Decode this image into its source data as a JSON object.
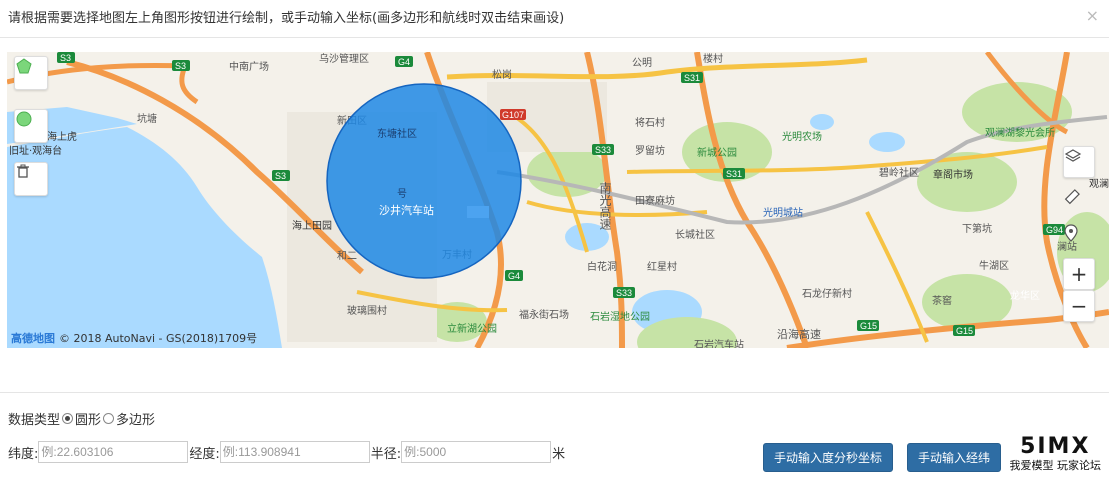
{
  "header": {
    "title": "请根据需要选择地图左上角图形按钮进行绘制，或手动输入坐标(画多边形和航线时双击结束画设)",
    "close": "×"
  },
  "map": {
    "labels": {
      "zhongnan": "中南广场",
      "wuyu": "乌沙管理区",
      "xinyan": "新田区",
      "kengtou": "坑塘",
      "hu": "海上虎",
      "haiyu": "旧址·观海台",
      "haishang": "海上田园",
      "he2": "和二",
      "bolanwei": "玻璃围村",
      "shajing": "沙井汽车站",
      "wanfeng": "万丰村",
      "lixin": "立新湖公园",
      "fuyong": "福永街石场",
      "shiyan": "石岩湿地公园",
      "shiyanbus": "石岩汽车站",
      "hongxingcun": "红星村",
      "baihua": "白花洞",
      "tianliao": "田寮麻坊",
      "changcheng": "长城社区",
      "luoliu": "罗留坊",
      "jiangshi": "将石村",
      "songgang": "松岗",
      "gongming": "公明",
      "louchun": "楼村",
      "xincheng": "新城公园",
      "guangming": "光明城站",
      "guangmingfarm": "光明农场",
      "guanlan": "观澜湖黎光会所",
      "zhanghu": "章阁市场",
      "bishan": "碧岭社区",
      "xiajing": "下第坑",
      "niuhu": "牛湖区",
      "chaxia": "茶窖",
      "huaqiao": "石龙仔新村",
      "longhua": "龙华区",
      "guanlan2": "观澜",
      "lannanjie": "澜站",
      "gaosu": "南光高速",
      "yanhai": "沿海高速"
    },
    "roads": [
      "S3",
      "S3",
      "G4",
      "S3",
      "S33",
      "S33",
      "S31",
      "G107",
      "S31",
      "G4",
      "G15",
      "G15",
      "G94"
    ],
    "attribution": "© 2018 AutoNavi - GS(2018)1709号",
    "attribution_logo": "高德地图"
  },
  "draw_tools": {
    "polygon": "polygon-icon",
    "circle": "circle-icon",
    "delete": "trash-icon"
  },
  "map_controls": {
    "layers": "layers-icon",
    "ruler": "ruler-icon",
    "marker": "location-pin-icon",
    "zoom_in": "+",
    "zoom_out": "−"
  },
  "form": {
    "data_type_label": "数据类型",
    "option_circle": "圆形",
    "option_polygon": "多边形",
    "lat_label": "纬度:",
    "lat_placeholder": "例:22.603106",
    "lng_label": "经度:",
    "lng_placeholder": "例:113.908941",
    "radius_label": "半径:",
    "radius_placeholder": "例:5000",
    "unit": "米",
    "btn_dms": "手动输入度分秒坐标",
    "btn_latlng": "手动输入经纬"
  },
  "watermark": {
    "big": "5IMX",
    "small": "我爱模型 玩家论坛"
  },
  "colors": {
    "circle_fill": "#1e88e5",
    "button": "#2e6da4",
    "highway": "#f39a4a",
    "expressway": "#f6c344",
    "water": "#aadaff",
    "park": "#c6e3a6"
  }
}
